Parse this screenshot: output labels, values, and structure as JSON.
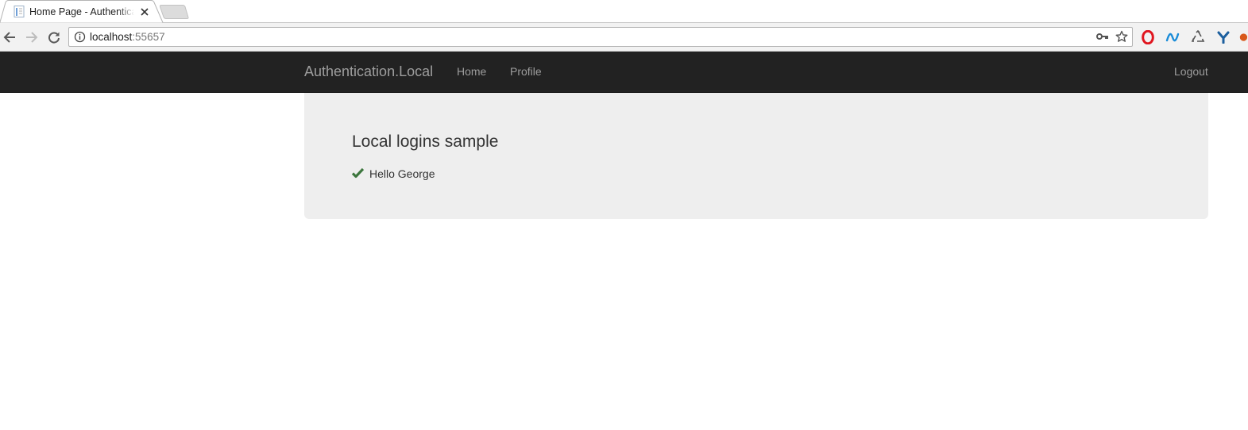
{
  "browser": {
    "tab": {
      "title": "Home Page - Authentication.Local",
      "favicon": "page-icon"
    },
    "new_tab": "new-tab-icon",
    "address": {
      "host": "localhost",
      "port": ":55657",
      "security_icon": "info-icon"
    },
    "toolbar_icons": [
      "back-icon",
      "forward-icon",
      "reload-icon",
      "key-icon",
      "star-icon"
    ],
    "extensions": [
      "opera-icon",
      "wave-icon",
      "recycle-icon",
      "y-icon"
    ]
  },
  "navbar": {
    "brand": "Authentication.Local",
    "links": [
      "Home",
      "Profile"
    ],
    "logout": "Logout",
    "background": "#222222",
    "link_color": "#9d9d9d"
  },
  "jumbotron": {
    "title": "Local logins sample",
    "message": "Hello George",
    "message_icon": "check-icon",
    "check_color": "#3c763d",
    "background": "#eeeeee"
  }
}
